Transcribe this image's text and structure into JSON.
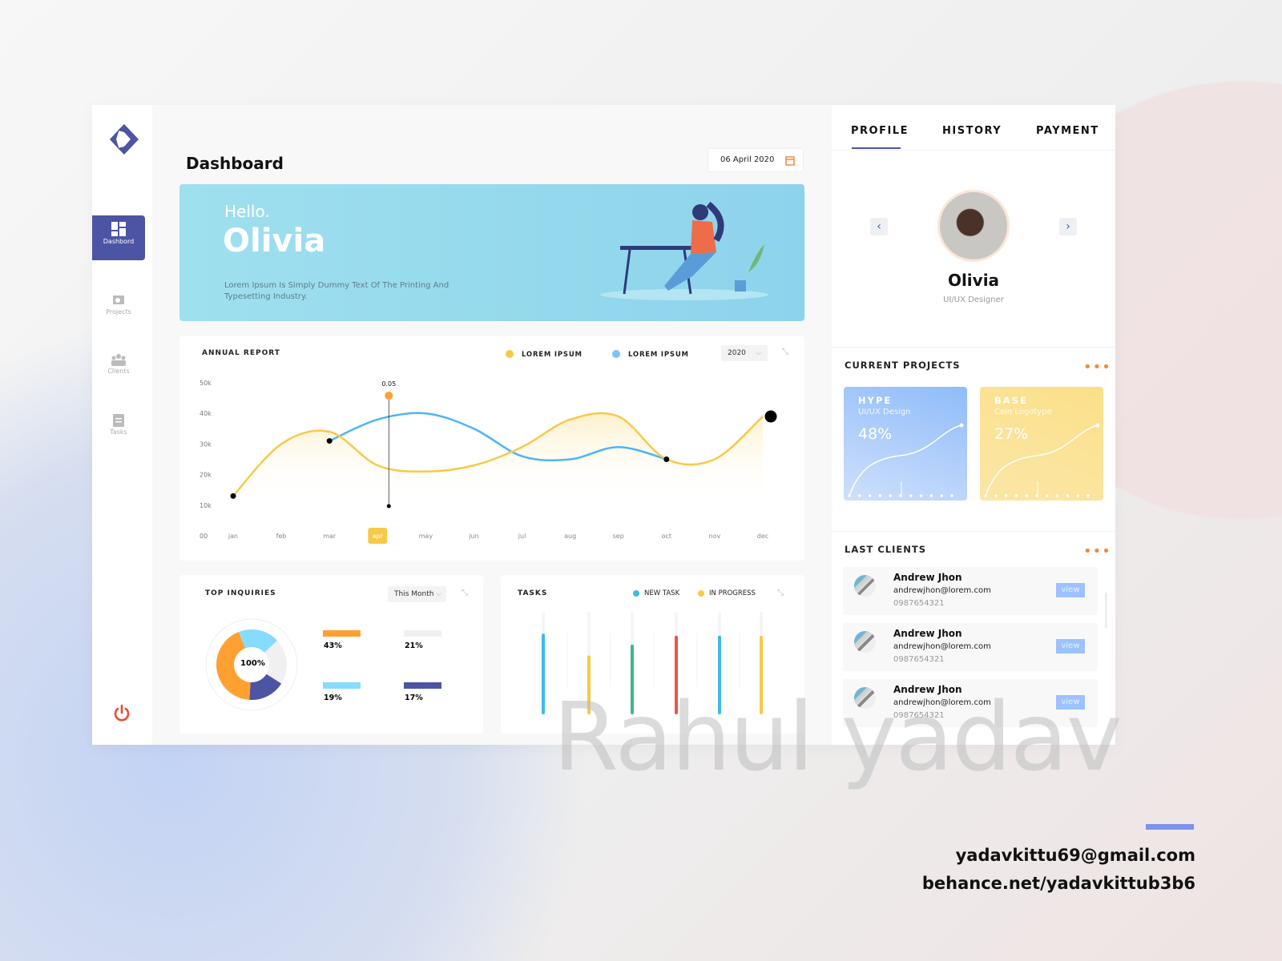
{
  "sidebar": {
    "items": [
      {
        "label": "Dashbord",
        "icon": "grid-icon"
      },
      {
        "label": "Projects",
        "icon": "presentation-icon"
      },
      {
        "label": "Clients",
        "icon": "users-icon"
      },
      {
        "label": "Tasks",
        "icon": "clipboard-icon"
      }
    ],
    "power_icon": "power-icon"
  },
  "header": {
    "title": "Dashboard",
    "date": "06 April 2020"
  },
  "hero": {
    "greeting": "Hello.",
    "name": "Olivia",
    "text_line1": "Lorem Ipsum Is Simply Dummy Text Of The Printing And",
    "text_line2": "Typesetting Industry."
  },
  "annual": {
    "title": "ANNUAL REPORT",
    "year": "2020",
    "tooltip": "0.05"
  },
  "chart_data": {
    "type": "line",
    "title": "ANNUAL REPORT",
    "categories": [
      "jan",
      "feb",
      "mar",
      "apr",
      "may",
      "jun",
      "jul",
      "aug",
      "sep",
      "oct",
      "nov",
      "dec"
    ],
    "highlighted_category": "apr",
    "yticks": [
      "00",
      "10k",
      "20k",
      "30k",
      "40k",
      "50k"
    ],
    "ylim": [
      0,
      50000
    ],
    "series": [
      {
        "name": "LOREM IPSUM",
        "color": "#f7c948",
        "values": [
          13000,
          30000,
          34000,
          23000,
          21000,
          23000,
          29000,
          38000,
          39000,
          25000,
          25000,
          39000
        ]
      },
      {
        "name": "LOREM IPSUM",
        "color": "#4db4f7",
        "values": [
          null,
          null,
          31000,
          38000,
          40000,
          35000,
          26000,
          25000,
          29000,
          25000,
          null,
          null
        ]
      }
    ]
  },
  "inquiries": {
    "title": "TOP INQUIRIES",
    "filter": "This Month",
    "center": "100%",
    "items": [
      {
        "pct": "43%",
        "value": 43,
        "color": "#ffa033"
      },
      {
        "pct": "21%",
        "value": 21,
        "color": "#f0f0f0"
      },
      {
        "pct": "19%",
        "value": 19,
        "color": "#86dbff"
      },
      {
        "pct": "17%",
        "value": 17,
        "color": "#4c54a4"
      }
    ]
  },
  "tasks": {
    "title": "TASKS",
    "legend": [
      {
        "label": "NEW TASK",
        "color": "#3dbbe8"
      },
      {
        "label": "IN PROGRESS",
        "color": "#f7c948"
      }
    ],
    "bars": [
      {
        "value": 0.78,
        "color": "#3dbbe8"
      },
      {
        "value": 0.56,
        "color": "#f7c948"
      },
      {
        "value": 0.67,
        "color": "#3fb68b"
      },
      {
        "value": 0.76,
        "color": "#ef5350"
      },
      {
        "value": 0.76,
        "color": "#3dbbe8"
      },
      {
        "value": 0.76,
        "color": "#f7c948"
      }
    ]
  },
  "profile": {
    "tabs": [
      "PROFILE",
      "HISTORY",
      "PAYMENT"
    ],
    "active_tab": "PROFILE",
    "name": "Olivia",
    "role": "UI/UX Designer"
  },
  "projects": {
    "title": "CURRENT PROJECTS",
    "items": [
      {
        "name": "HYPE",
        "sub": "UI/UX Design",
        "pct": "48%",
        "progress": 48
      },
      {
        "name": "BASE",
        "sub": "Coin Logotype",
        "pct": "27%",
        "progress": 27
      }
    ]
  },
  "clients": {
    "title": "LAST CLIENTS",
    "items": [
      {
        "name": "Andrew Jhon",
        "email": "andrewjhon@lorem.com",
        "phone": "0987654321",
        "action": "view"
      },
      {
        "name": "Andrew Jhon",
        "email": "andrewjhon@lorem.com",
        "phone": "0987654321",
        "action": "view"
      },
      {
        "name": "Andrew Jhon",
        "email": "andrewjhon@lorem.com",
        "phone": "0987654321",
        "action": "view"
      }
    ]
  },
  "watermark": "Rahul yadav",
  "footer": {
    "email": "yadavkittu69@gmail.com",
    "behance": "behance.net/yadavkittub3b6"
  }
}
